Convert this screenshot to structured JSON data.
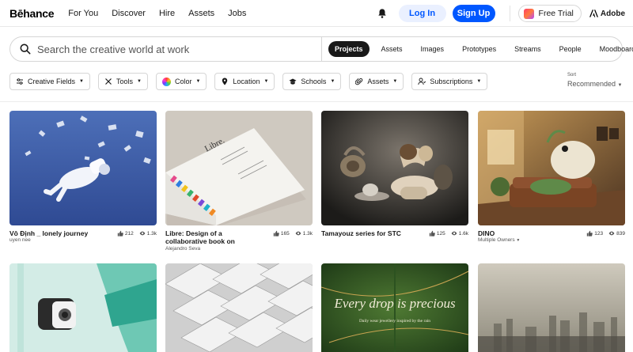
{
  "header": {
    "logo": "Bēhance",
    "nav": [
      "For You",
      "Discover",
      "Hire",
      "Assets",
      "Jobs"
    ],
    "login": "Log In",
    "signup": "Sign Up",
    "free_trial": "Free Trial",
    "adobe": "Adobe"
  },
  "search": {
    "placeholder": "Search the creative world at work",
    "tabs": [
      "Projects",
      "Assets",
      "Images",
      "Prototypes",
      "Streams",
      "People",
      "Moodboards"
    ],
    "active_tab": "Projects"
  },
  "filters": [
    "Creative Fields",
    "Tools",
    "Color",
    "Location",
    "Schools",
    "Assets",
    "Subscriptions"
  ],
  "sort": {
    "label": "Sort",
    "value": "Recommended"
  },
  "projects": [
    {
      "title": "Vô Định _ lonely journey",
      "owner": "uyen nee",
      "likes": "212",
      "views": "1.3k"
    },
    {
      "title": "Libre: Design of a collaborative book on",
      "owner": "Alejandro Seva",
      "likes": "165",
      "views": "1.3k"
    },
    {
      "title": "Tamayouz series for STC",
      "owner": "",
      "likes": "125",
      "views": "1.6k"
    },
    {
      "title": "DINO",
      "owner": "Multiple Owners",
      "likes": "123",
      "views": "839"
    }
  ],
  "thumb_text": {
    "libre_cover": "Libre.",
    "jewelry_headline": "Every drop is precious",
    "jewelry_sub": "Daily wear jewellery inspired by the rain"
  },
  "colors": {
    "accent": "#0057ff",
    "text": "#191919",
    "muted": "#555555"
  }
}
